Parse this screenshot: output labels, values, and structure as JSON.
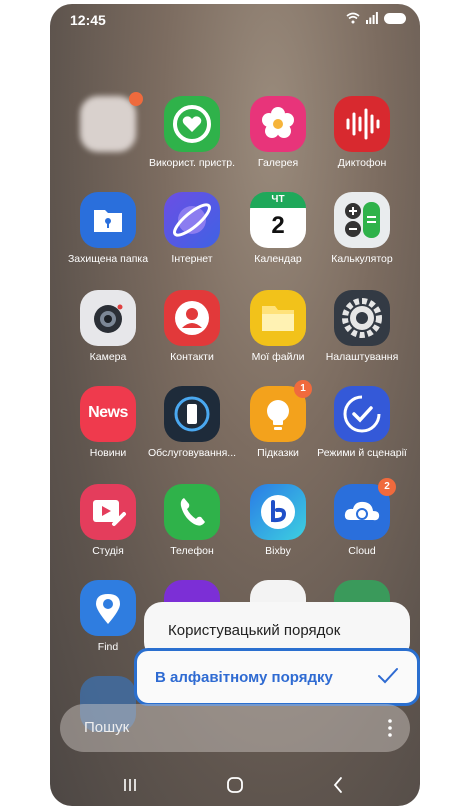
{
  "status": {
    "time": "12:45"
  },
  "apps": [
    {
      "label": "",
      "color": "#d8d0cc"
    },
    {
      "label": "Використ. пристр.",
      "color": "#2fb24a"
    },
    {
      "label": "Галерея",
      "color": "#e8347a"
    },
    {
      "label": "Диктофон",
      "color": "#d8292f"
    },
    {
      "label": "Захищена папка",
      "color": "#2a6fdc"
    },
    {
      "label": "Інтернет",
      "color": "#5b4fe0"
    },
    {
      "label": "Календар",
      "color": "#ffffff"
    },
    {
      "label": "Калькулятор",
      "color": "#2fb24a"
    },
    {
      "label": "Камера",
      "color": "#e7e7ea"
    },
    {
      "label": "Контакти",
      "color": "#e2393a"
    },
    {
      "label": "Мої файли",
      "color": "#f2c21a"
    },
    {
      "label": "Налаштування",
      "color": "#333a44"
    },
    {
      "label": "Новини",
      "color": "#ef3a4d",
      "icon_text": "News"
    },
    {
      "label": "Обслуговування...",
      "color": "#1e2b3a"
    },
    {
      "label": "Підказки",
      "color": "#f3a21c",
      "badge": "1"
    },
    {
      "label": "Режими й сценарії",
      "color": "#3459d8"
    },
    {
      "label": "Студія",
      "color": "#e43d5c"
    },
    {
      "label": "Телефон",
      "color": "#2fb24a"
    },
    {
      "label": "Bixby",
      "color": "#2a7be6"
    },
    {
      "label": "Cloud",
      "color": "#2a6fdc",
      "badge": "2"
    },
    {
      "label": "Find",
      "color": "#2f7de0"
    }
  ],
  "calendar_icon": {
    "day": "ЧТ",
    "date": "2"
  },
  "sort_menu": {
    "option1": "Користувацький порядок",
    "option2": "В алфавітному порядку"
  },
  "search": {
    "placeholder": "Пошук"
  },
  "colors": {
    "accent": "#2a6fcf"
  }
}
